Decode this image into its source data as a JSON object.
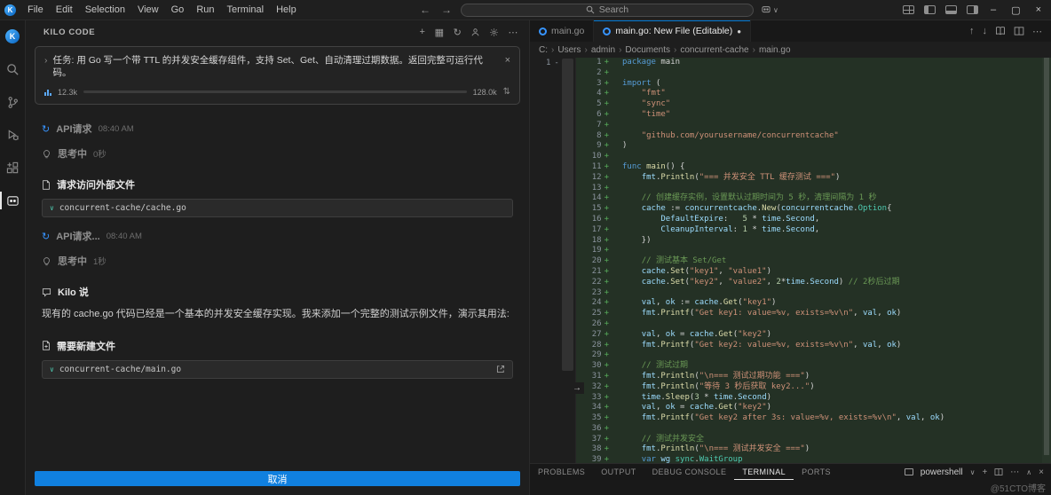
{
  "colors": {
    "accent_blue": "#1080df",
    "diff_added_bg": "rgba(70,149,74,0.16)"
  },
  "icons": {
    "back": "←",
    "forward": "→",
    "arrow_up": "↑",
    "arrow_down": "↓",
    "history": "↻",
    "chevron_right": "›",
    "chevron_down": "∨",
    "chevron_up": "∧",
    "close": "×",
    "plus": "+",
    "ellipsis": "⋯",
    "minimize": "–",
    "maximize": "▢",
    "modified_dot": "●",
    "updown": "⇅",
    "diff_next": "→",
    "grid": "▦",
    "diff_minus": "-"
  },
  "titlebar": {
    "menus": [
      "File",
      "Edit",
      "Selection",
      "View",
      "Go",
      "Run",
      "Terminal",
      "Help"
    ],
    "search_placeholder": "Search"
  },
  "kilo_panel": {
    "title": "KILO CODE",
    "task_label": "任务: 用 Go 写一个带 TTL 的并发安全缓存组件，支持 Set、Get、自动清理过期数据。返回完整可运行代码。",
    "tokens": {
      "used": "12.3k",
      "max": "128.0k",
      "progress_pct": 11
    },
    "timeline": [
      {
        "type": "api",
        "label": "API请求",
        "time": "08:40 AM"
      },
      {
        "type": "thinking",
        "label": "思考中",
        "duration": "0秒"
      },
      {
        "type": "file_request",
        "label": "请求访问外部文件",
        "file": "concurrent-cache/cache.go"
      },
      {
        "type": "api",
        "label": "API请求...",
        "time": "08:40 AM"
      },
      {
        "type": "thinking",
        "label": "思考中",
        "duration": "1秒"
      },
      {
        "type": "say",
        "label": "Kilo 说",
        "text": "现有的 cache.go 代码已经是一个基本的并发安全缓存实现。我来添加一个完整的测试示例文件，演示其用法:"
      },
      {
        "type": "new_file",
        "label": "需要新建文件",
        "file": "concurrent-cache/main.go"
      }
    ],
    "cancel_label": "取消"
  },
  "editor": {
    "tabs": [
      {
        "label": "main.go",
        "active": false,
        "modified": false
      },
      {
        "label": "main.go: New File (Editable)",
        "active": true,
        "modified": true
      }
    ],
    "breadcrumb": [
      "C:",
      "Users",
      "admin",
      "Documents",
      "concurrent-cache",
      "main.go"
    ],
    "original_line_number": "1",
    "code_lines": [
      [
        [
          "k",
          "package"
        ],
        [
          "p",
          " main"
        ]
      ],
      [],
      [
        [
          "k",
          "import"
        ],
        [
          "p",
          " ("
        ]
      ],
      [
        [
          "p",
          "    "
        ],
        [
          "s",
          "\"fmt\""
        ]
      ],
      [
        [
          "p",
          "    "
        ],
        [
          "s",
          "\"sync\""
        ]
      ],
      [
        [
          "p",
          "    "
        ],
        [
          "s",
          "\"time\""
        ]
      ],
      [],
      [
        [
          "p",
          "    "
        ],
        [
          "s",
          "\"github.com/yourusername/concurrentcache\""
        ]
      ],
      [
        [
          "p",
          ")"
        ]
      ],
      [],
      [
        [
          "k",
          "func"
        ],
        [
          "p",
          " "
        ],
        [
          "f",
          "main"
        ],
        [
          "p",
          "() {"
        ]
      ],
      [
        [
          "p",
          "    "
        ],
        [
          "v",
          "fmt"
        ],
        [
          "p",
          "."
        ],
        [
          "f",
          "Println"
        ],
        [
          "p",
          "("
        ],
        [
          "s",
          "\"=== 并发安全 TTL 缓存测试 ===\""
        ],
        [
          "p",
          ")"
        ]
      ],
      [],
      [
        [
          "p",
          "    "
        ],
        [
          "c",
          "// 创建缓存实例，设置默认过期时间为 5 秒，清理间隔为 1 秒"
        ]
      ],
      [
        [
          "p",
          "    "
        ],
        [
          "v",
          "cache"
        ],
        [
          "p",
          " := "
        ],
        [
          "v",
          "concurrentcache"
        ],
        [
          "p",
          "."
        ],
        [
          "f",
          "New"
        ],
        [
          "p",
          "("
        ],
        [
          "v",
          "concurrentcache"
        ],
        [
          "p",
          "."
        ],
        [
          "t",
          "Option"
        ],
        [
          "p",
          "{"
        ]
      ],
      [
        [
          "p",
          "        "
        ],
        [
          "v",
          "DefaultExpire"
        ],
        [
          "p",
          ":   "
        ],
        [
          "n",
          "5"
        ],
        [
          "p",
          " * "
        ],
        [
          "v",
          "time"
        ],
        [
          "p",
          "."
        ],
        [
          "v",
          "Second"
        ],
        [
          "p",
          ","
        ]
      ],
      [
        [
          "p",
          "        "
        ],
        [
          "v",
          "CleanupInterval"
        ],
        [
          "p",
          ": "
        ],
        [
          "n",
          "1"
        ],
        [
          "p",
          " * "
        ],
        [
          "v",
          "time"
        ],
        [
          "p",
          "."
        ],
        [
          "v",
          "Second"
        ],
        [
          "p",
          ","
        ]
      ],
      [
        [
          "p",
          "    })"
        ]
      ],
      [],
      [
        [
          "p",
          "    "
        ],
        [
          "c",
          "// 测试基本 Set/Get"
        ]
      ],
      [
        [
          "p",
          "    "
        ],
        [
          "v",
          "cache"
        ],
        [
          "p",
          "."
        ],
        [
          "f",
          "Set"
        ],
        [
          "p",
          "("
        ],
        [
          "s",
          "\"key1\""
        ],
        [
          "p",
          ", "
        ],
        [
          "s",
          "\"value1\""
        ],
        [
          "p",
          ")"
        ]
      ],
      [
        [
          "p",
          "    "
        ],
        [
          "v",
          "cache"
        ],
        [
          "p",
          "."
        ],
        [
          "f",
          "Set"
        ],
        [
          "p",
          "("
        ],
        [
          "s",
          "\"key2\""
        ],
        [
          "p",
          ", "
        ],
        [
          "s",
          "\"value2\""
        ],
        [
          "p",
          ", "
        ],
        [
          "n",
          "2"
        ],
        [
          "p",
          "*"
        ],
        [
          "v",
          "time"
        ],
        [
          "p",
          "."
        ],
        [
          "v",
          "Second"
        ],
        [
          "p",
          ") "
        ],
        [
          "c",
          "// 2秒后过期"
        ]
      ],
      [],
      [
        [
          "p",
          "    "
        ],
        [
          "v",
          "val"
        ],
        [
          "p",
          ", "
        ],
        [
          "v",
          "ok"
        ],
        [
          "p",
          " := "
        ],
        [
          "v",
          "cache"
        ],
        [
          "p",
          "."
        ],
        [
          "f",
          "Get"
        ],
        [
          "p",
          "("
        ],
        [
          "s",
          "\"key1\""
        ],
        [
          "p",
          ")"
        ]
      ],
      [
        [
          "p",
          "    "
        ],
        [
          "v",
          "fmt"
        ],
        [
          "p",
          "."
        ],
        [
          "f",
          "Printf"
        ],
        [
          "p",
          "("
        ],
        [
          "s",
          "\"Get key1: value=%v, exists=%v\\n\""
        ],
        [
          "p",
          ", "
        ],
        [
          "v",
          "val"
        ],
        [
          "p",
          ", "
        ],
        [
          "v",
          "ok"
        ],
        [
          "p",
          ")"
        ]
      ],
      [],
      [
        [
          "p",
          "    "
        ],
        [
          "v",
          "val"
        ],
        [
          "p",
          ", "
        ],
        [
          "v",
          "ok"
        ],
        [
          "p",
          " = "
        ],
        [
          "v",
          "cache"
        ],
        [
          "p",
          "."
        ],
        [
          "f",
          "Get"
        ],
        [
          "p",
          "("
        ],
        [
          "s",
          "\"key2\""
        ],
        [
          "p",
          ")"
        ]
      ],
      [
        [
          "p",
          "    "
        ],
        [
          "v",
          "fmt"
        ],
        [
          "p",
          "."
        ],
        [
          "f",
          "Printf"
        ],
        [
          "p",
          "("
        ],
        [
          "s",
          "\"Get key2: value=%v, exists=%v\\n\""
        ],
        [
          "p",
          ", "
        ],
        [
          "v",
          "val"
        ],
        [
          "p",
          ", "
        ],
        [
          "v",
          "ok"
        ],
        [
          "p",
          ")"
        ]
      ],
      [],
      [
        [
          "p",
          "    "
        ],
        [
          "c",
          "// 测试过期"
        ]
      ],
      [
        [
          "p",
          "    "
        ],
        [
          "v",
          "fmt"
        ],
        [
          "p",
          "."
        ],
        [
          "f",
          "Println"
        ],
        [
          "p",
          "("
        ],
        [
          "s",
          "\"\\n=== 测试过期功能 ===\""
        ],
        [
          "p",
          ")"
        ]
      ],
      [
        [
          "p",
          "    "
        ],
        [
          "v",
          "fmt"
        ],
        [
          "p",
          "."
        ],
        [
          "f",
          "Println"
        ],
        [
          "p",
          "("
        ],
        [
          "s",
          "\"等待 3 秒后获取 key2...\""
        ],
        [
          "p",
          ")"
        ]
      ],
      [
        [
          "p",
          "    "
        ],
        [
          "v",
          "time"
        ],
        [
          "p",
          "."
        ],
        [
          "f",
          "Sleep"
        ],
        [
          "p",
          "("
        ],
        [
          "n",
          "3"
        ],
        [
          "p",
          " * "
        ],
        [
          "v",
          "time"
        ],
        [
          "p",
          "."
        ],
        [
          "v",
          "Second"
        ],
        [
          "p",
          ")"
        ]
      ],
      [
        [
          "p",
          "    "
        ],
        [
          "v",
          "val"
        ],
        [
          "p",
          ", "
        ],
        [
          "v",
          "ok"
        ],
        [
          "p",
          " = "
        ],
        [
          "v",
          "cache"
        ],
        [
          "p",
          "."
        ],
        [
          "f",
          "Get"
        ],
        [
          "p",
          "("
        ],
        [
          "s",
          "\"key2\""
        ],
        [
          "p",
          ")"
        ]
      ],
      [
        [
          "p",
          "    "
        ],
        [
          "v",
          "fmt"
        ],
        [
          "p",
          "."
        ],
        [
          "f",
          "Printf"
        ],
        [
          "p",
          "("
        ],
        [
          "s",
          "\"Get key2 after 3s: value=%v, exists=%v\\n\""
        ],
        [
          "p",
          ", "
        ],
        [
          "v",
          "val"
        ],
        [
          "p",
          ", "
        ],
        [
          "v",
          "ok"
        ],
        [
          "p",
          ")"
        ]
      ],
      [],
      [
        [
          "p",
          "    "
        ],
        [
          "c",
          "// 测试并发安全"
        ]
      ],
      [
        [
          "p",
          "    "
        ],
        [
          "v",
          "fmt"
        ],
        [
          "p",
          "."
        ],
        [
          "f",
          "Println"
        ],
        [
          "p",
          "("
        ],
        [
          "s",
          "\"\\n=== 测试并发安全 ===\""
        ],
        [
          "p",
          ")"
        ]
      ],
      [
        [
          "p",
          "    "
        ],
        [
          "k",
          "var"
        ],
        [
          "p",
          " "
        ],
        [
          "v",
          "wg"
        ],
        [
          "p",
          " "
        ],
        [
          "t",
          "sync"
        ],
        [
          "p",
          "."
        ],
        [
          "t",
          "WaitGroup"
        ]
      ]
    ]
  },
  "bottom_panel": {
    "tabs": [
      "PROBLEMS",
      "OUTPUT",
      "DEBUG CONSOLE",
      "TERMINAL",
      "PORTS"
    ],
    "active_tab": "TERMINAL",
    "shell_label": "powershell"
  },
  "watermark": "@51CTO博客"
}
